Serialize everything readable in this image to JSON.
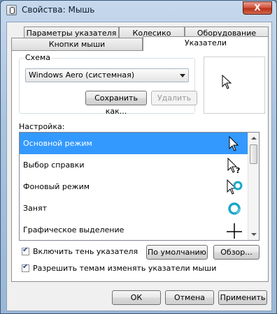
{
  "window": {
    "title": "Свойства: Мышь",
    "close_label": "X"
  },
  "tabs": {
    "row1": [
      "Параметры указателя",
      "Колесико",
      "Оборудование"
    ],
    "row2": [
      "Кнопки мыши",
      "Указатели"
    ]
  },
  "scheme": {
    "group_label": "Схема",
    "selected": "Windows Aero (системная)",
    "save_as_label": "Сохранить как...",
    "delete_label": "Удалить"
  },
  "settings": {
    "label": "Настройка:",
    "items": [
      {
        "label": "Основной режим",
        "icon": "arrow-cursor-icon",
        "selected": true
      },
      {
        "label": "Выбор справки",
        "icon": "help-cursor-icon",
        "selected": false
      },
      {
        "label": "Фоновый режим",
        "icon": "working-in-background-cursor-icon",
        "selected": false
      },
      {
        "label": "Занят",
        "icon": "busy-cursor-icon",
        "selected": false
      },
      {
        "label": "Графическое выделение",
        "icon": "precision-select-cursor-icon",
        "selected": false
      }
    ]
  },
  "options": {
    "shadow_label": "Включить тень указателя",
    "shadow_checked": true,
    "themes_label": "Разрешить темам изменять указатели мыши",
    "themes_checked": true,
    "default_label": "По умолчанию",
    "browse_label": "Обзор..."
  },
  "buttons": {
    "ok": "ОК",
    "cancel": "Отмена",
    "apply": "Применить"
  },
  "colors": {
    "selection": "#3399ff",
    "window_frame": "#a9c3e0"
  }
}
